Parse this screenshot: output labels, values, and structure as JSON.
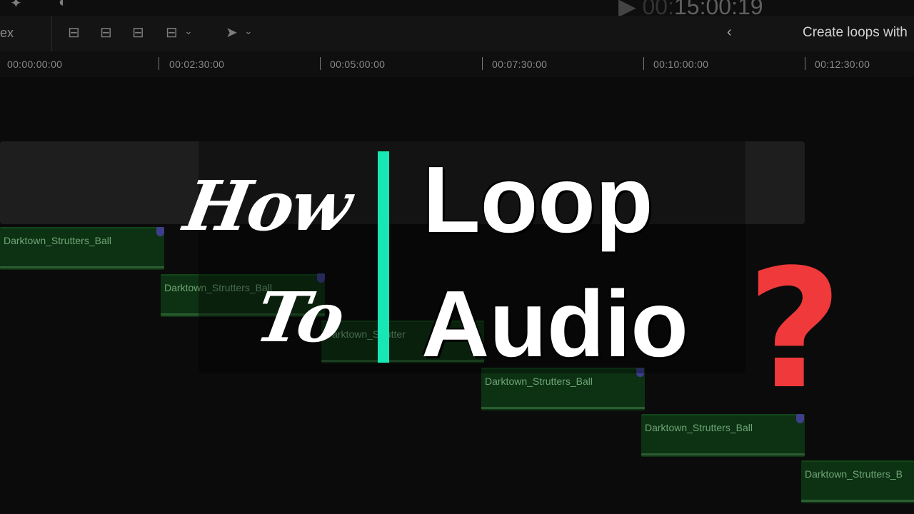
{
  "topbar": {
    "timecode_dim": "00:",
    "timecode": "15:00:19"
  },
  "toolbar": {
    "index_label": "ex",
    "back_icon": "chevron-left-icon",
    "panel_title": "Create loops with"
  },
  "ruler": {
    "ticks": [
      "00:00:00:00",
      "00:02:30:00",
      "00:05:00:00",
      "00:07:30:00",
      "00:10:00:00",
      "00:12:30:00"
    ]
  },
  "clips": [
    {
      "name": "Darktown_Strutters_Ball"
    },
    {
      "name": "Darktown_Strutters_Ball"
    },
    {
      "name": "Darktown_Strutter"
    },
    {
      "name": "Darktown_Strutters_Ball"
    },
    {
      "name": "Darktown_Strutters_Ball"
    },
    {
      "name": "Darktown_Strutters_B"
    }
  ],
  "title": {
    "how": "How",
    "to": "To",
    "loop": "Loop",
    "audio": "Audio",
    "question": "?"
  },
  "colors": {
    "accent_divider": "#19e6b5",
    "question_mark": "#f0393b",
    "clip_fill": "#0d3213"
  }
}
